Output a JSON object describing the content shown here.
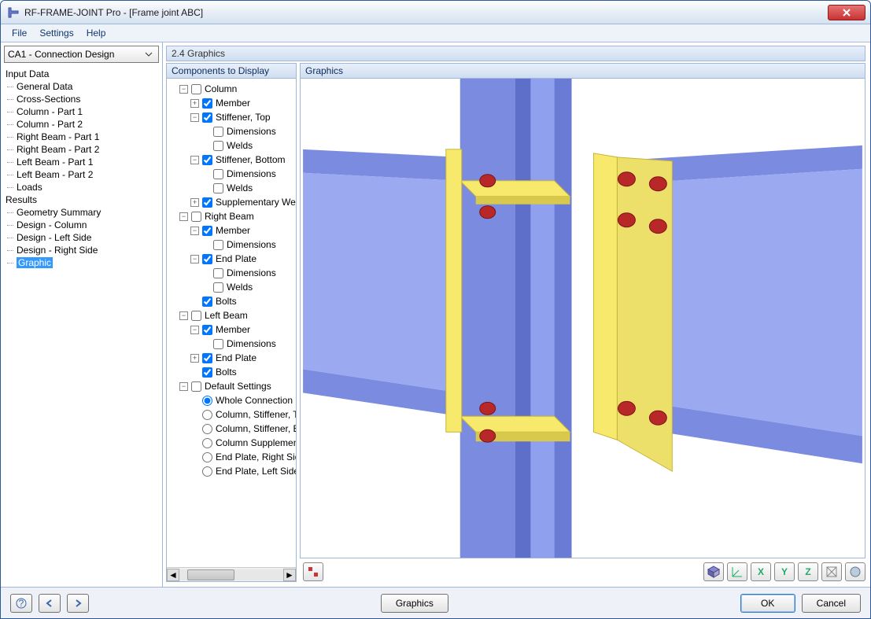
{
  "app": {
    "title": "RF-FRAME-JOINT Pro - [Frame joint ABC]"
  },
  "menu": {
    "file": "File",
    "settings": "Settings",
    "help": "Help"
  },
  "nav": {
    "combo": "CA1 - Connection Design",
    "input_data": "Input Data",
    "items_input": [
      "General Data",
      "Cross-Sections",
      "Column - Part 1",
      "Column - Part 2",
      "Right Beam - Part 1",
      "Right Beam - Part 2",
      "Left Beam - Part 1",
      "Left Beam - Part 2",
      "Loads"
    ],
    "results": "Results",
    "items_results": [
      "Geometry Summary",
      "Design - Column",
      "Design - Left Side",
      "Design - Right Side",
      "Graphic"
    ],
    "selected": "Graphic"
  },
  "panel": {
    "header": "2.4 Graphics",
    "components": "Components to Display",
    "graphics": "Graphics"
  },
  "tree": {
    "column": "Column",
    "member": "Member",
    "stiffener_top": "Stiffener, Top",
    "dimensions": "Dimensions",
    "welds": "Welds",
    "stiffener_bottom": "Stiffener, Bottom",
    "supp_web": "Supplementary Web Plate",
    "right_beam": "Right Beam",
    "end_plate": "End Plate",
    "bolts": "Bolts",
    "left_beam": "Left Beam",
    "default_settings": "Default Settings",
    "whole_conn": "Whole Connection",
    "col_stiff_top": "Column, Stiffener, Top",
    "col_stiff_bot": "Column, Stiffener, Bottom",
    "col_supp": "Column Supplementary",
    "ep_right": "End Plate, Right Side",
    "ep_left": "End Plate, Left Side"
  },
  "buttons": {
    "graphics": "Graphics",
    "ok": "OK",
    "cancel": "Cancel"
  }
}
